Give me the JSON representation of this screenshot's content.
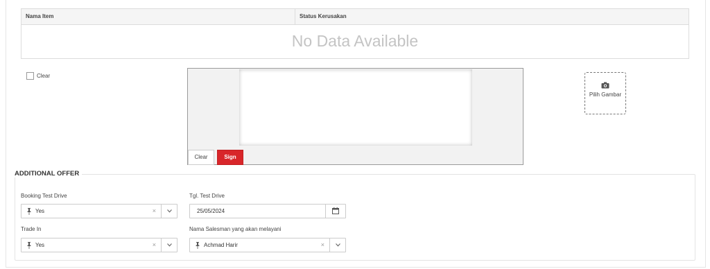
{
  "damage_table": {
    "col_item": "Nama Item",
    "col_status": "Status Kerusakan",
    "empty_text": "No Data Available"
  },
  "clear_checkbox": {
    "label": "Clear",
    "checked": false
  },
  "signature": {
    "clear_label": "Clear",
    "sign_label": "Sign"
  },
  "image_picker": {
    "label": "Pilih Gambar",
    "icon": "camera-icon"
  },
  "additional_offer": {
    "title": "ADDITIONAL OFFER",
    "booking_test_drive": {
      "label": "Booking Test Drive",
      "value": "Yes"
    },
    "tgl_test_drive": {
      "label": "Tgl. Test Drive",
      "value": "25/05/2024"
    },
    "trade_in": {
      "label": "Trade In",
      "value": "Yes"
    },
    "salesman": {
      "label": "Nama Salesman yang akan melayani",
      "value": "Achmad Harir"
    },
    "clear_symbol": "×"
  },
  "colors": {
    "sign_button": "#d8262a",
    "border": "#cccccc",
    "nodata_text": "#c4c4c4"
  }
}
